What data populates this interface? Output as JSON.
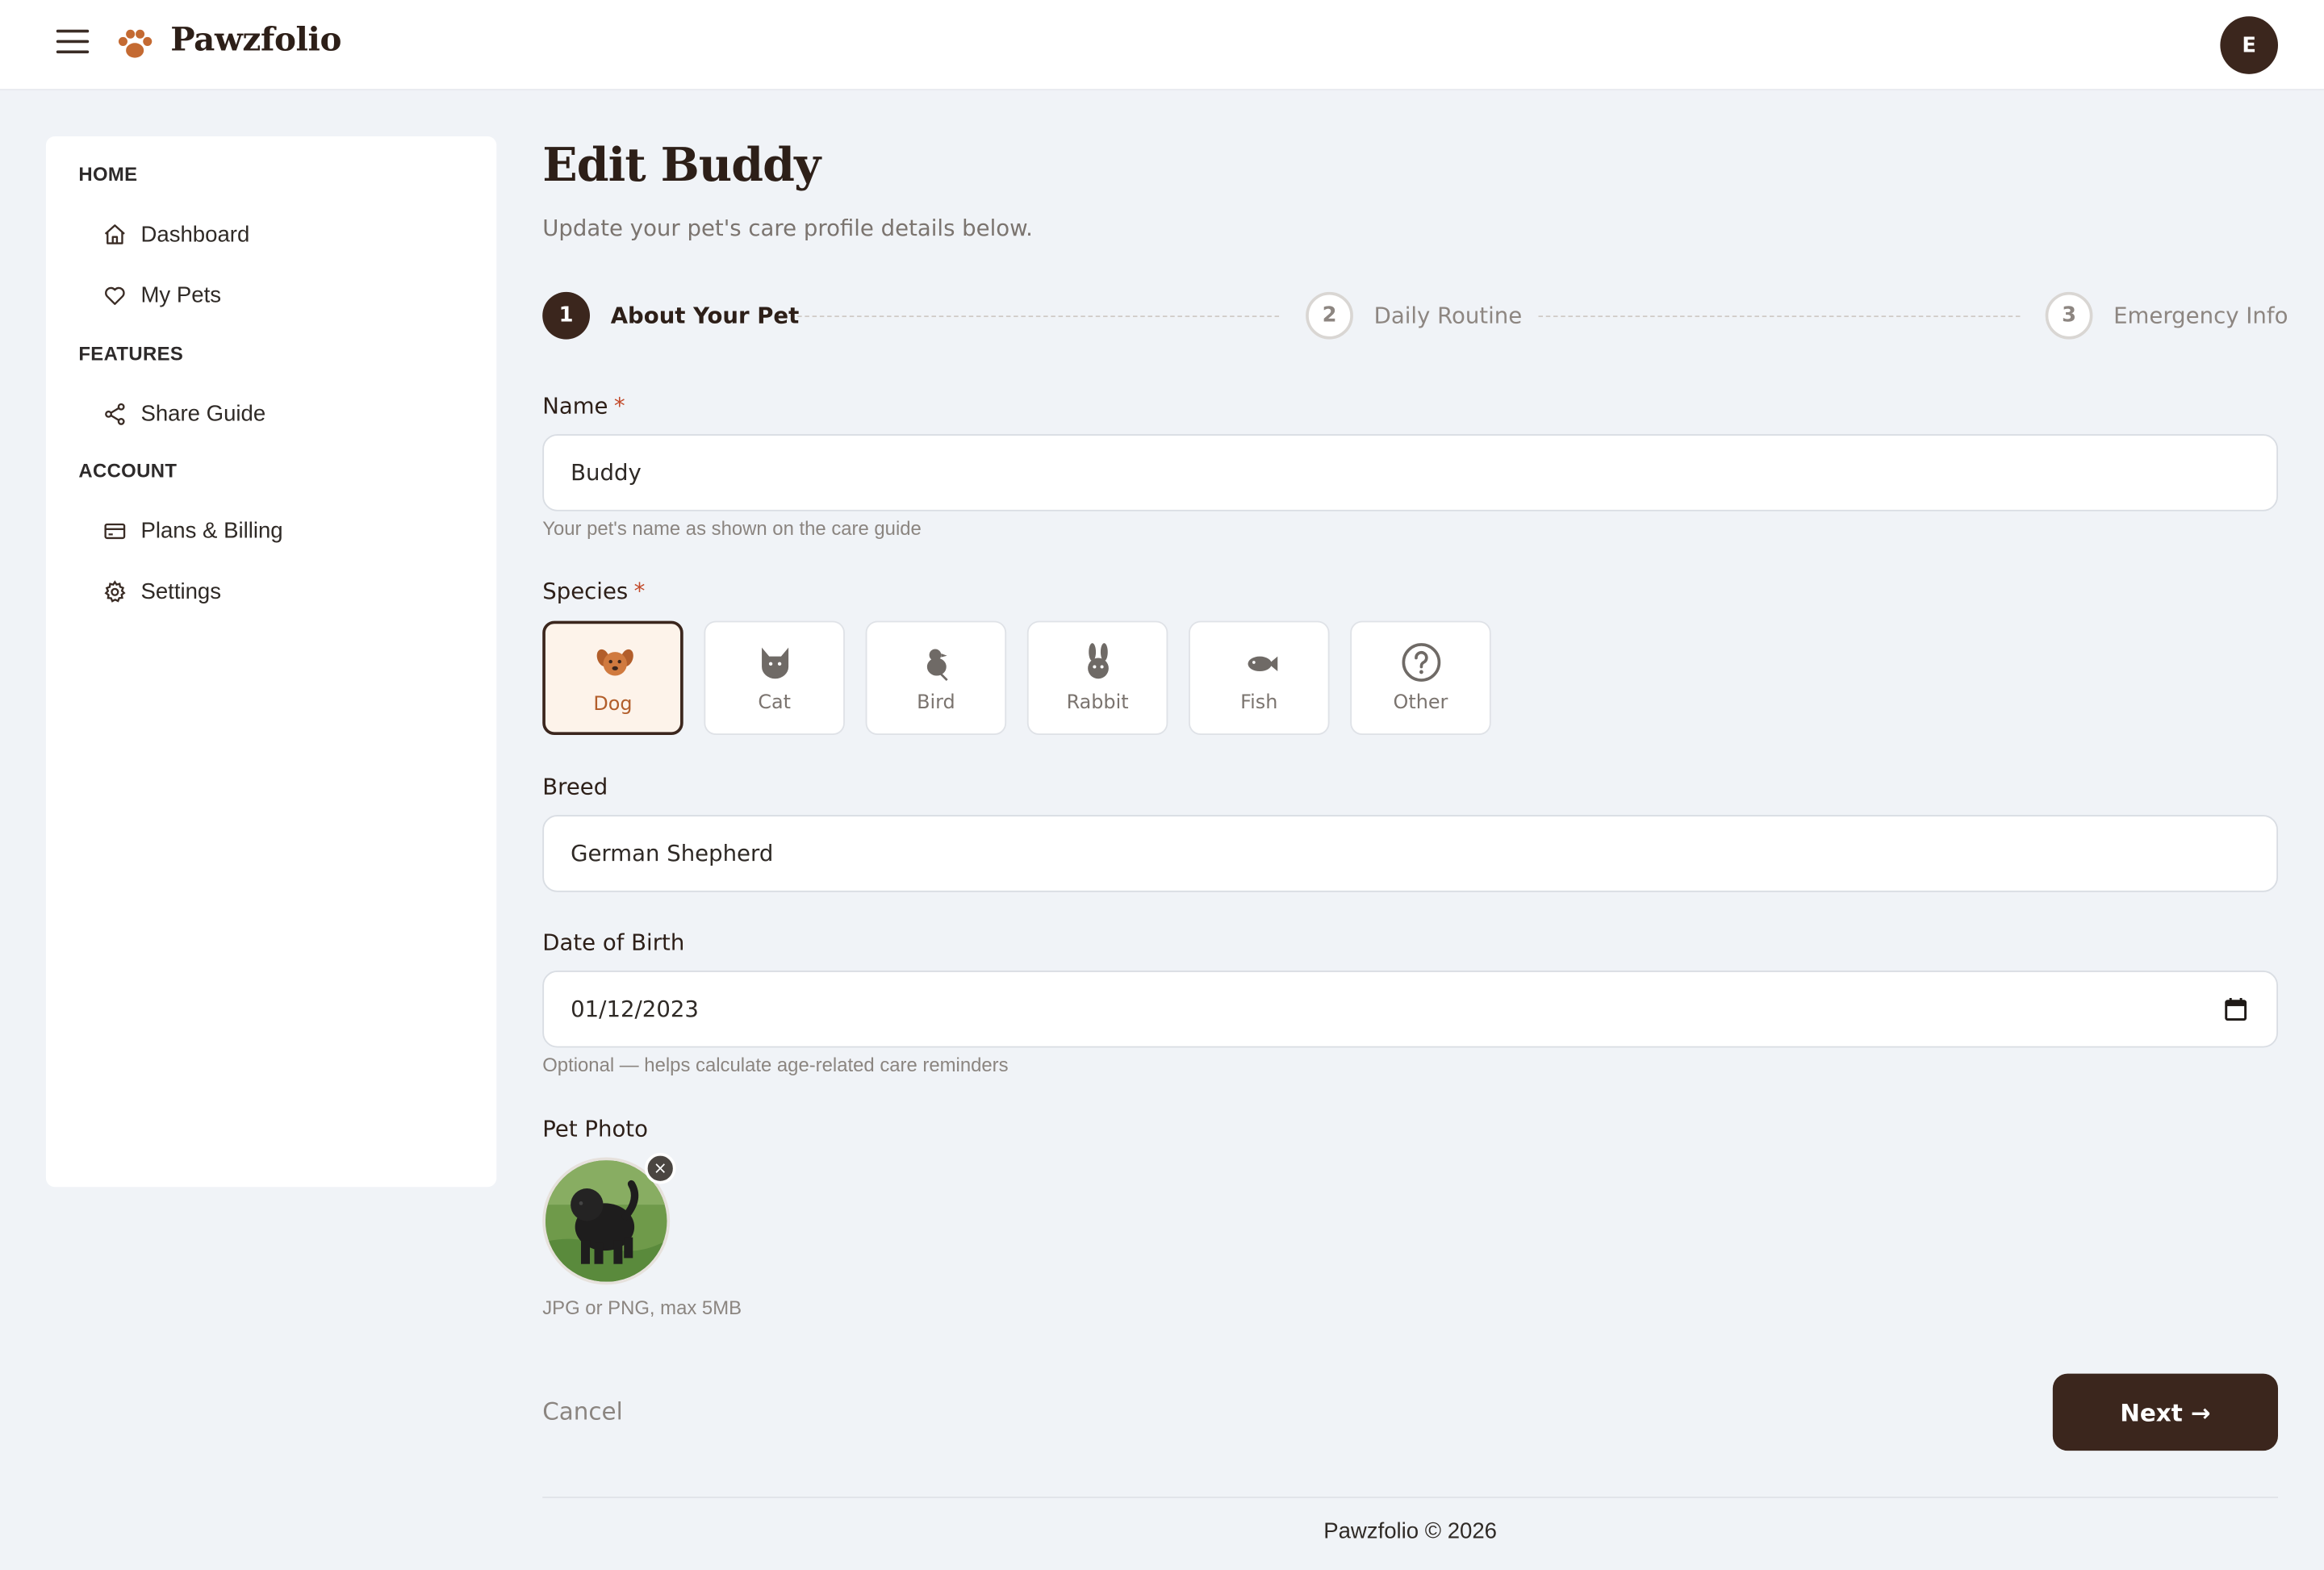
{
  "app": {
    "brand": "Pawzfolio",
    "avatar_initial": "E"
  },
  "sidebar": {
    "sections": [
      {
        "title": "HOME",
        "items": [
          {
            "label": "Dashboard",
            "icon": "home-icon"
          },
          {
            "label": "My Pets",
            "icon": "heart-icon"
          }
        ]
      },
      {
        "title": "FEATURES",
        "items": [
          {
            "label": "Share Guide",
            "icon": "share-icon"
          }
        ]
      },
      {
        "title": "ACCOUNT",
        "items": [
          {
            "label": "Plans & Billing",
            "icon": "credit-card-icon"
          },
          {
            "label": "Settings",
            "icon": "gear-icon"
          }
        ]
      }
    ]
  },
  "page": {
    "title": "Edit Buddy",
    "subtitle": "Update your pet's care profile details below."
  },
  "stepper": {
    "steps": [
      {
        "number": "1",
        "label": "About Your Pet",
        "state": "active"
      },
      {
        "number": "2",
        "label": "Daily Routine",
        "state": "upcoming"
      },
      {
        "number": "3",
        "label": "Emergency Info",
        "state": "upcoming"
      }
    ]
  },
  "form": {
    "name": {
      "label": "Name",
      "required_mark": "*",
      "value": "Buddy",
      "hint": "Your pet's name as shown on the care guide"
    },
    "species": {
      "label": "Species",
      "required_mark": "*",
      "selected": "Dog",
      "options": [
        {
          "label": "Dog",
          "icon": "dog-icon"
        },
        {
          "label": "Cat",
          "icon": "cat-icon"
        },
        {
          "label": "Bird",
          "icon": "bird-icon"
        },
        {
          "label": "Rabbit",
          "icon": "rabbit-icon"
        },
        {
          "label": "Fish",
          "icon": "fish-icon"
        },
        {
          "label": "Other",
          "icon": "question-icon"
        }
      ]
    },
    "breed": {
      "label": "Breed",
      "value": "German Shepherd"
    },
    "dob": {
      "label": "Date of Birth",
      "value": "01/12/2023",
      "hint": "Optional — helps calculate age-related care reminders"
    },
    "photo": {
      "label": "Pet Photo",
      "remove_glyph": "×",
      "hint": "JPG or PNG, max 5MB"
    }
  },
  "actions": {
    "cancel": "Cancel",
    "next": "Next →"
  },
  "footer": {
    "text": "Pawzfolio © 2026"
  },
  "colors": {
    "primary": "#3b261d",
    "accent": "#c46a32",
    "selected_bg": "#fdf3ea",
    "page_bg": "#f0f3f7"
  }
}
